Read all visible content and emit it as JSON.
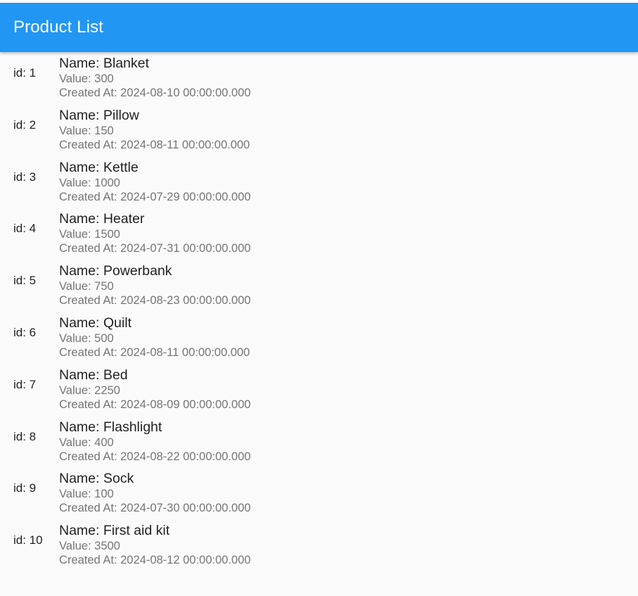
{
  "colors": {
    "app_bar": "#2196f3",
    "background": "#fafafa",
    "primary_text": "#222222",
    "secondary_text": "#757575"
  },
  "app_bar": {
    "title": "Product List"
  },
  "products": [
    {
      "id_label": "id: 1",
      "name": "Name: Blanket",
      "value": "Value: 300",
      "created": "Created At: 2024-08-10 00:00:00.000"
    },
    {
      "id_label": "id: 2",
      "name": "Name: Pillow",
      "value": "Value: 150",
      "created": "Created At: 2024-08-11 00:00:00.000"
    },
    {
      "id_label": "id: 3",
      "name": "Name: Kettle",
      "value": "Value: 1000",
      "created": "Created At: 2024-07-29 00:00:00.000"
    },
    {
      "id_label": "id: 4",
      "name": "Name: Heater",
      "value": "Value: 1500",
      "created": "Created At: 2024-07-31 00:00:00.000"
    },
    {
      "id_label": "id: 5",
      "name": "Name: Powerbank",
      "value": "Value: 750",
      "created": "Created At: 2024-08-23 00:00:00.000"
    },
    {
      "id_label": "id: 6",
      "name": "Name: Quilt",
      "value": "Value: 500",
      "created": "Created At: 2024-08-11 00:00:00.000"
    },
    {
      "id_label": "id: 7",
      "name": "Name: Bed",
      "value": "Value: 2250",
      "created": "Created At: 2024-08-09 00:00:00.000"
    },
    {
      "id_label": "id: 8",
      "name": "Name: Flashlight",
      "value": "Value: 400",
      "created": "Created At: 2024-08-22 00:00:00.000"
    },
    {
      "id_label": "id: 9",
      "name": "Name: Sock",
      "value": "Value: 100",
      "created": "Created At: 2024-07-30 00:00:00.000"
    },
    {
      "id_label": "id: 10",
      "name": "Name: First aid kit",
      "value": "Value: 3500",
      "created": "Created At: 2024-08-12 00:00:00.000"
    }
  ]
}
